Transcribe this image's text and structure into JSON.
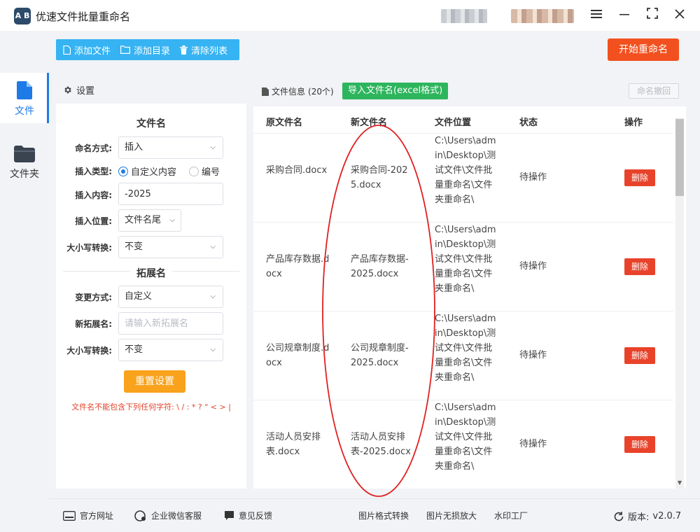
{
  "app": {
    "logo_text": "A B",
    "title": "优速文件批量重命名"
  },
  "window": {
    "menu_icon": "hamburger-icon",
    "minimize_icon": "minimize-icon",
    "maximize_icon": "maximize-icon",
    "close_icon": "close-icon"
  },
  "nav": {
    "items": [
      {
        "label": "文件",
        "icon": "file-icon"
      },
      {
        "label": "文件夹",
        "icon": "folder-icon"
      }
    ]
  },
  "toolbar": {
    "add_file": "添加文件",
    "add_dir": "添加目录",
    "clear_list": "清除列表",
    "start": "开始重命名"
  },
  "settings": {
    "header": "设置",
    "filename_section": "文件名",
    "naming_mode_label": "命名方式:",
    "naming_mode_value": "插入",
    "insert_type_label": "插入类型:",
    "insert_type_options": [
      "自定义内容",
      "编号"
    ],
    "insert_content_label": "插入内容:",
    "insert_content_value": "-2025",
    "insert_pos_label": "插入位置:",
    "insert_pos_value": "文件名尾",
    "case_label": "大小写转换:",
    "case_value": "不变",
    "ext_section": "拓展名",
    "change_mode_label": "变更方式:",
    "change_mode_value": "自定义",
    "new_ext_label": "新拓展名:",
    "new_ext_placeholder": "请输入新拓展名",
    "ext_case_label": "大小写转换:",
    "ext_case_value": "不变",
    "reset": "重置设置",
    "warning": "文件名不能包含下列任何字符: \\ / : * ? \" < > |"
  },
  "files": {
    "info_label": "文件信息",
    "count": "(20个)",
    "import_btn": "导入文件名(excel格式)",
    "undo_btn": "命名撤回",
    "columns": [
      "原文件名",
      "新文件名",
      "文件位置",
      "状态",
      "操作"
    ],
    "rows": [
      {
        "orig": "采购合同.docx",
        "new": "采购合同-2025.docx",
        "path": "C:\\Users\\admin\\Desktop\\测试文件\\文件批量重命名\\文件夹重命名\\",
        "status": "待操作",
        "action": "删除"
      },
      {
        "orig": "产品库存数据.docx",
        "new": "产品库存数据-2025.docx",
        "path": "C:\\Users\\admin\\Desktop\\测试文件\\文件批量重命名\\文件夹重命名\\",
        "status": "待操作",
        "action": "删除"
      },
      {
        "orig": "公司规章制度.docx",
        "new": "公司规章制度-2025.docx",
        "path": "C:\\Users\\admin\\Desktop\\测试文件\\文件批量重命名\\文件夹重命名\\",
        "status": "待操作",
        "action": "删除"
      },
      {
        "orig": "活动人员安排表.docx",
        "new": "活动人员安排表-2025.docx",
        "path": "C:\\Users\\admin\\Desktop\\测试文件\\文件批量重命名\\文件夹重命名\\",
        "status": "待操作",
        "action": "删除"
      }
    ]
  },
  "bottom": {
    "official_site": "官方网址",
    "wechat_service": "企业微信客服",
    "feedback": "意见反馈",
    "img_convert": "图片格式转换",
    "img_enlarge": "图片无损放大",
    "watermark": "水印工厂",
    "version_label": "版本:",
    "version_value": "v2.0.7"
  },
  "colors": {
    "accent_blue": "#36b3f2",
    "start_red": "#f2511f",
    "reset_orange": "#f9a21b",
    "import_green": "#2db55d",
    "delete_red": "#e8432a",
    "annotation_red": "#e02020"
  }
}
